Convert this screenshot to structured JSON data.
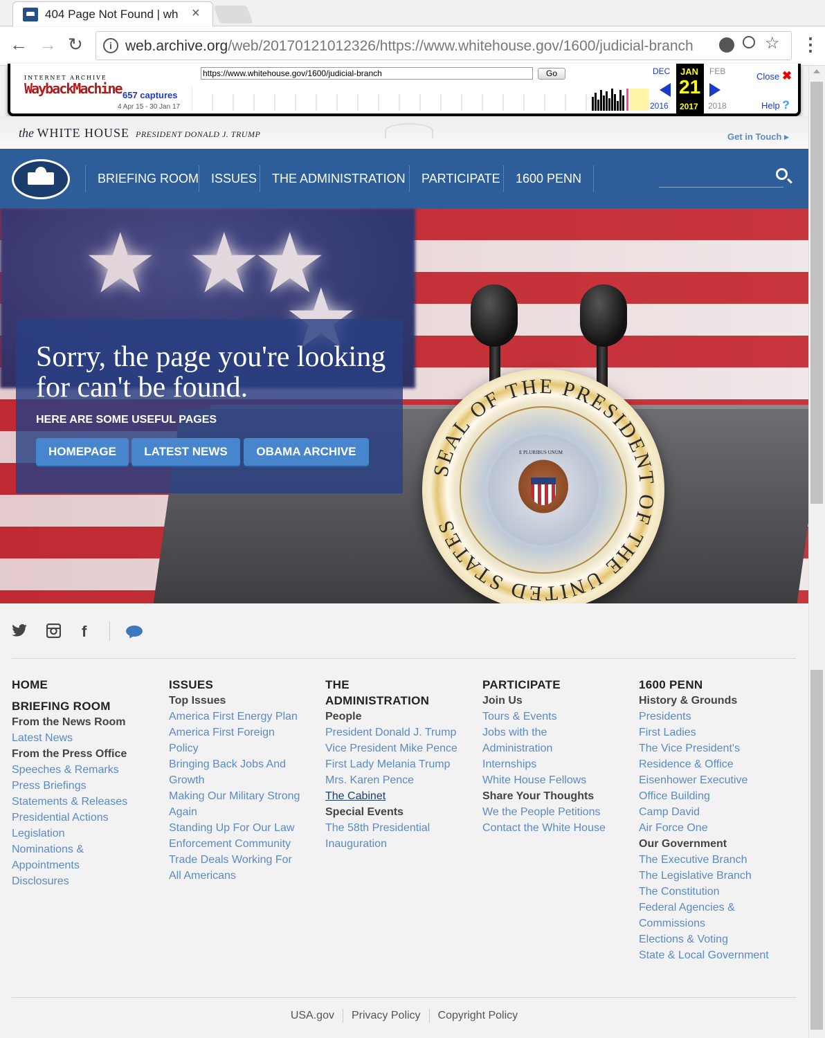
{
  "browser": {
    "tab_title": "404 Page Not Found | wh",
    "tab_close": "×",
    "url_host": "web.archive.org",
    "url_path": "/web/20170121012326/https://www.whitehouse.gov/1600/judicial-branch"
  },
  "wayback": {
    "logo_top": "INTERNET ARCHIVE",
    "logo": "WaybackMachine",
    "url_input": "https://www.whitehouse.gov/1600/judicial-branch",
    "go_label": "Go",
    "captures": "657 captures",
    "range": "4 Apr 15 - 30 Jan 17",
    "prev_month": "DEC",
    "prev_year": "2016",
    "cur_month": "JAN",
    "cur_day": "21",
    "cur_year": "2017",
    "next_month": "FEB",
    "next_year": "2018",
    "close_label": "Close",
    "help_label": "Help"
  },
  "site": {
    "brand_prefix": "the ",
    "brand": "WHITE HOUSE",
    "president": "PRESIDENT DONALD J. TRUMP",
    "get_in_touch": "Get in Touch ▸"
  },
  "nav": {
    "items": [
      "BRIEFING ROOM",
      "ISSUES",
      "THE ADMINISTRATION",
      "PARTICIPATE",
      "1600 PENN"
    ]
  },
  "hero": {
    "heading": "Sorry, the page you're looking for can't be found.",
    "sub": "HERE ARE SOME USEFUL PAGES",
    "buttons": [
      "HOMEPAGE",
      "LATEST NEWS",
      "OBAMA ARCHIVE"
    ],
    "seal_text": "SEAL OF THE PRESIDENT OF THE UNITED STATES",
    "seal_motto": "E PLURIBUS UNUM"
  },
  "footer": {
    "columns": [
      {
        "entries": [
          {
            "type": "title",
            "text": "HOME"
          },
          {
            "type": "gap"
          },
          {
            "type": "title",
            "text": "BRIEFING ROOM"
          },
          {
            "type": "sub",
            "text": "From the News Room"
          },
          {
            "type": "link",
            "text": "Latest News"
          },
          {
            "type": "sub",
            "text": "From the Press Office"
          },
          {
            "type": "link",
            "text": "Speeches & Remarks"
          },
          {
            "type": "link",
            "text": "Press Briefings"
          },
          {
            "type": "link",
            "text": "Statements & Releases"
          },
          {
            "type": "link",
            "text": "Presidential Actions"
          },
          {
            "type": "link",
            "text": "Legislation"
          },
          {
            "type": "link",
            "text": "Nominations &"
          },
          {
            "type": "link",
            "text": "Appointments"
          },
          {
            "type": "link",
            "text": "Disclosures"
          }
        ]
      },
      {
        "entries": [
          {
            "type": "title",
            "text": "ISSUES"
          },
          {
            "type": "sub",
            "text": "Top Issues"
          },
          {
            "type": "link",
            "text": "America First Energy Plan"
          },
          {
            "type": "link",
            "text": "America First Foreign"
          },
          {
            "type": "link",
            "text": "Policy"
          },
          {
            "type": "link",
            "text": "Bringing Back Jobs And"
          },
          {
            "type": "link",
            "text": "Growth"
          },
          {
            "type": "link",
            "text": "Making Our Military Strong"
          },
          {
            "type": "link",
            "text": "Again"
          },
          {
            "type": "link",
            "text": "Standing Up For Our Law"
          },
          {
            "type": "link",
            "text": "Enforcement Community"
          },
          {
            "type": "link",
            "text": "Trade Deals Working For"
          },
          {
            "type": "link",
            "text": "All Americans"
          }
        ]
      },
      {
        "entries": [
          {
            "type": "title",
            "text": "THE"
          },
          {
            "type": "title",
            "text": "ADMINISTRATION"
          },
          {
            "type": "sub",
            "text": "People"
          },
          {
            "type": "link",
            "text": "President Donald J. Trump"
          },
          {
            "type": "link",
            "text": "Vice President Mike Pence"
          },
          {
            "type": "link",
            "text": "First Lady Melania Trump"
          },
          {
            "type": "link",
            "text": "Mrs. Karen Pence"
          },
          {
            "type": "dark",
            "text": "The Cabinet"
          },
          {
            "type": "sub",
            "text": "Special Events"
          },
          {
            "type": "link",
            "text": "The 58th Presidential"
          },
          {
            "type": "link",
            "text": "Inauguration"
          }
        ]
      },
      {
        "entries": [
          {
            "type": "title",
            "text": "PARTICIPATE"
          },
          {
            "type": "sub",
            "text": "Join Us"
          },
          {
            "type": "link",
            "text": "Tours & Events"
          },
          {
            "type": "link",
            "text": "Jobs with the"
          },
          {
            "type": "link",
            "text": "Administration"
          },
          {
            "type": "link",
            "text": "Internships"
          },
          {
            "type": "link",
            "text": "White House Fellows"
          },
          {
            "type": "sub",
            "text": "Share Your Thoughts"
          },
          {
            "type": "link",
            "text": "We the People Petitions"
          },
          {
            "type": "link",
            "text": "Contact the White House"
          }
        ]
      },
      {
        "entries": [
          {
            "type": "title",
            "text": "1600 PENN"
          },
          {
            "type": "sub",
            "text": "History & Grounds"
          },
          {
            "type": "link",
            "text": "Presidents"
          },
          {
            "type": "link",
            "text": "First Ladies"
          },
          {
            "type": "link",
            "text": "The Vice President's"
          },
          {
            "type": "link",
            "text": "Residence & Office"
          },
          {
            "type": "link",
            "text": "Eisenhower Executive"
          },
          {
            "type": "link",
            "text": "Office Building"
          },
          {
            "type": "link",
            "text": "Camp David"
          },
          {
            "type": "link",
            "text": "Air Force One"
          },
          {
            "type": "sub",
            "text": "Our Government"
          },
          {
            "type": "link",
            "text": "The Executive Branch"
          },
          {
            "type": "link",
            "text": "The Legislative Branch"
          },
          {
            "type": "link",
            "text": "The Constitution"
          },
          {
            "type": "link",
            "text": "Federal Agencies &"
          },
          {
            "type": "link",
            "text": "Commissions"
          },
          {
            "type": "link",
            "text": "Elections & Voting"
          },
          {
            "type": "link",
            "text": "State & Local Government"
          }
        ]
      }
    ],
    "legal": [
      "USA.gov",
      "Privacy Policy",
      "Copyright Policy"
    ]
  },
  "colors": {
    "nav_blue": "#2d5e99",
    "link_blue": "#5a8ac6",
    "button_blue": "#4786cc",
    "wayback_blue": "#1c39cc"
  },
  "icons": [
    "back-arrow-icon",
    "forward-arrow-icon",
    "reload-icon",
    "info-icon",
    "zoom-icon",
    "star-icon",
    "menu-icon",
    "search-icon",
    "twitter-icon",
    "instagram-icon",
    "facebook-icon",
    "chat-icon"
  ]
}
